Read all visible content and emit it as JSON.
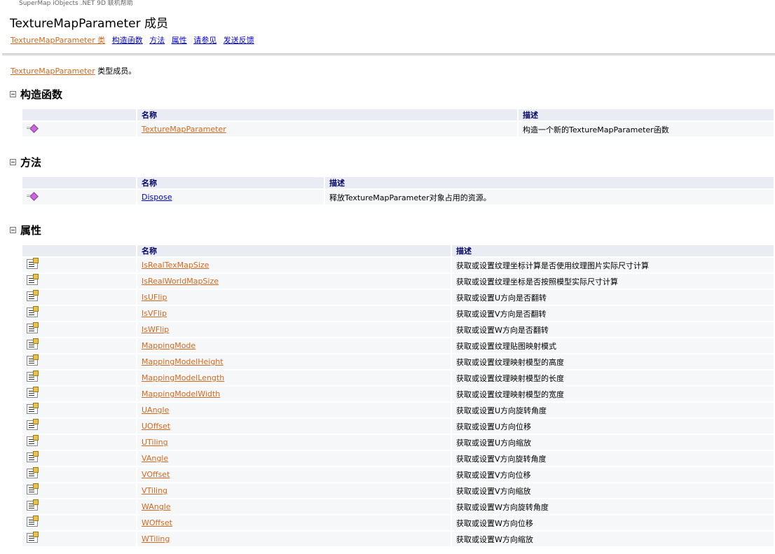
{
  "header": {
    "product": "SuperMap iObjects .NET 9D 联机帮助",
    "title": "TextureMapParameter 成员",
    "links": [
      "TextureMapParameter 类",
      "构造函数",
      "方法",
      "属性",
      "请参见",
      "发送反馈"
    ]
  },
  "intro": {
    "link": "TextureMapParameter",
    "text": " 类型成员。"
  },
  "columns": {
    "name": "名称",
    "desc": "描述"
  },
  "constructors": {
    "heading": "构造函数",
    "rows": [
      {
        "name": "TextureMapParameter",
        "desc": "构造一个新的TextureMapParameter函数"
      }
    ]
  },
  "methods": {
    "heading": "方法",
    "rows": [
      {
        "name": "Dispose",
        "desc": "释放TextureMapParameter对象占用的资源。"
      }
    ]
  },
  "properties": {
    "heading": "属性",
    "rows": [
      {
        "name": "IsRealTexMapSize",
        "desc": "获取或设置纹理坐标计算是否使用纹理图片实际尺寸计算"
      },
      {
        "name": "IsRealWorldMapSize",
        "desc": "获取或设置纹理坐标是否按照模型实际尺寸计算"
      },
      {
        "name": "IsUFlip",
        "desc": "获取或设置U方向是否翻转"
      },
      {
        "name": "IsVFlip",
        "desc": "获取或设置V方向是否翻转"
      },
      {
        "name": "IsWFlip",
        "desc": "获取或设置W方向是否翻转"
      },
      {
        "name": "MappingMode",
        "desc": "获取或设置纹理贴图映射模式"
      },
      {
        "name": "MappingModelHeight",
        "desc": "获取或设置纹理映射模型的高度"
      },
      {
        "name": "MappingModelLength",
        "desc": "获取或设置纹理映射模型的长度"
      },
      {
        "name": "MappingModelWidth",
        "desc": "获取或设置纹理映射模型的宽度"
      },
      {
        "name": "UAngle",
        "desc": "获取或设置U方向旋转角度"
      },
      {
        "name": "UOffset",
        "desc": "获取或设置U方向位移"
      },
      {
        "name": "UTiling",
        "desc": "获取或设置U方向缩放"
      },
      {
        "name": "VAngle",
        "desc": "获取或设置V方向旋转角度"
      },
      {
        "name": "VOffset",
        "desc": "获取或设置V方向位移"
      },
      {
        "name": "VTiling",
        "desc": "获取或设置V方向缩放"
      },
      {
        "name": "WAngle",
        "desc": "获取或设置W方向旋转角度"
      },
      {
        "name": "WOffset",
        "desc": "获取或设置W方向位移"
      },
      {
        "name": "WTiling",
        "desc": "获取或设置W方向缩放"
      }
    ]
  },
  "colors": {
    "link_orange": "#d2691e",
    "link_blue": "#0000cc",
    "header_text": "#000066"
  },
  "icons": {
    "method": "method-icon",
    "property": "property-icon",
    "collapse": "collapse-icon"
  }
}
